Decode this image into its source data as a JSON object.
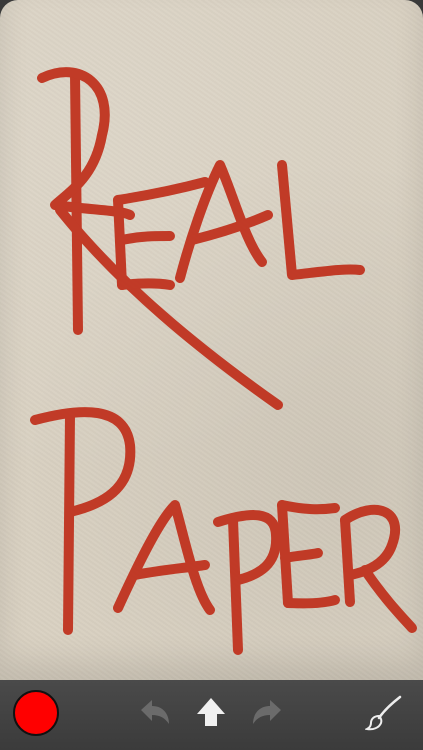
{
  "canvas": {
    "paper_color": "#d9d1c2",
    "ink_color": "#c0331f",
    "drawn_text": [
      "REAL",
      "PAPER"
    ]
  },
  "toolbar": {
    "background": "#3b3b3b",
    "color_swatch": "#ff0000",
    "undo_icon": "undo-arrow-icon",
    "share_icon": "up-arrow-icon",
    "redo_icon": "redo-arrow-icon",
    "brush_icon": "paintbrush-icon"
  }
}
